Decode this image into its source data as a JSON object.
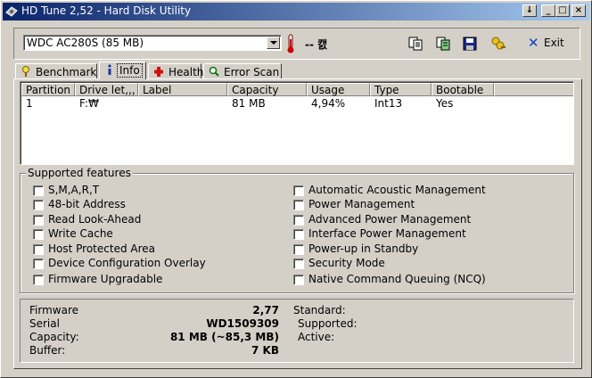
{
  "window": {
    "title": "HD Tune 2,52 - Hard Disk Utility",
    "controls": {
      "menu": "↓",
      "minimize": "_",
      "maximize": "□",
      "close": "×"
    }
  },
  "toolbar": {
    "drive": "WDC AC280S (85 MB)",
    "temperature": "-- 캜",
    "exit_label": "Exit"
  },
  "tabs": [
    {
      "label": "Benchmark",
      "icon": "stopwatch-icon"
    },
    {
      "label": "Info",
      "icon": "info-icon"
    },
    {
      "label": "Health",
      "icon": "health-cross-icon"
    },
    {
      "label": "Error Scan",
      "icon": "magnifier-icon"
    }
  ],
  "partitions": {
    "columns": [
      "Partition",
      "Drive let,,,",
      "Label",
      "Capacity",
      "Usage",
      "Type",
      "Bootable"
    ],
    "rows": [
      {
        "partition": "1",
        "drive": "F:₩",
        "label": "",
        "capacity": "81 MB",
        "usage": "4,94%",
        "type": "Int13",
        "bootable": "Yes"
      }
    ]
  },
  "features": {
    "title": "Supported features",
    "left": [
      "S,M,A,R,T",
      "48-bit Address",
      "Read Look-Ahead",
      "Write Cache",
      "Host Protected Area",
      "Device Configuration Overlay",
      "Firmware Upgradable"
    ],
    "right": [
      "Automatic Acoustic Management",
      "Power Management",
      "Advanced Power Management",
      "Interface Power Management",
      "Power-up in Standby",
      "Security Mode",
      "Native Command Queuing (NCQ)"
    ]
  },
  "info": {
    "firmware_label": "Firmware",
    "firmware": "2,77",
    "serial_label": "Serial",
    "serial": "WD1509309",
    "capacity_label": "Capacity:",
    "capacity": "81 MB (~85,3 MB)",
    "buffer_label": "Buffer:",
    "buffer": "7 KB",
    "standard_label": "Standard:",
    "supported_label": "Supported:",
    "active_label": "Active:"
  }
}
